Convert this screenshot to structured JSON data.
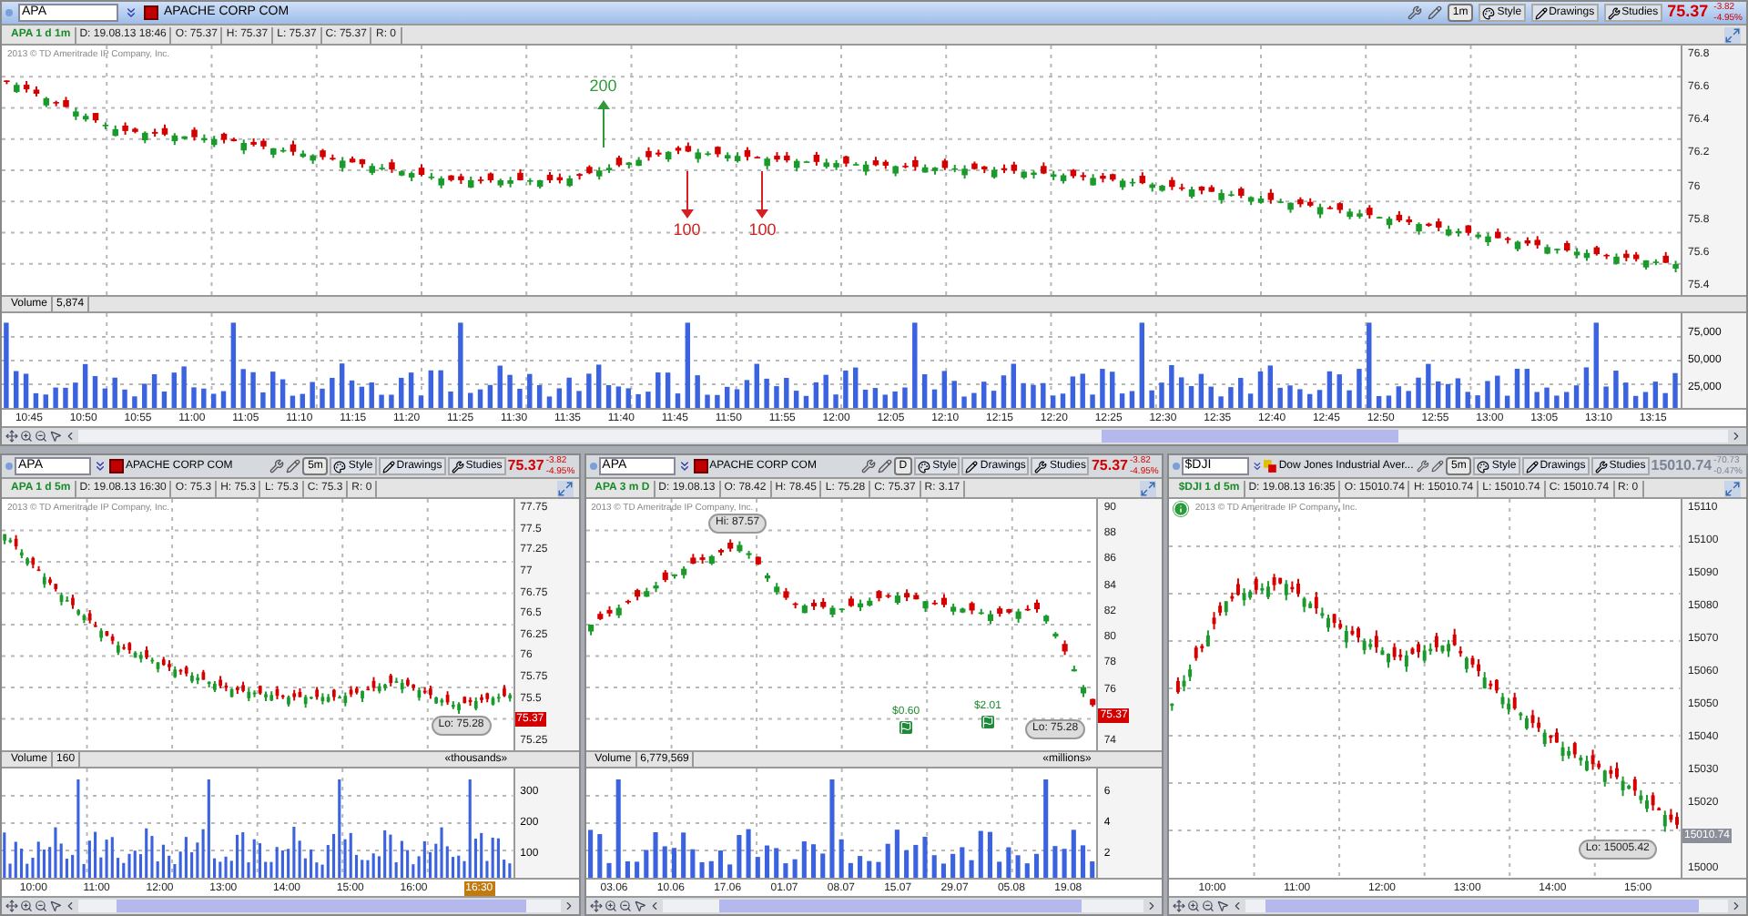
{
  "panels": [
    {
      "symbol": "APA",
      "company": "APACHE CORP COM",
      "interval": "1m",
      "style": "Style",
      "drawings": "Drawings",
      "studies": "Studies",
      "price": "75.37",
      "color": "#d40000",
      "change": "-3.82",
      "change_pct": "-4.95%",
      "info": [
        "APA 1 d 1m",
        "D: 19.08.13 18:46",
        "O: 75.37",
        "H: 75.37",
        "L: 75.37",
        "C: 75.37",
        "R: 0"
      ],
      "copyright": "2013 © TD Ameritrade IP Company, Inc.",
      "price_axis": [
        {
          "kind": "tick",
          "label": "76.8"
        },
        {
          "kind": "tick",
          "label": "76.6"
        },
        {
          "kind": "tick",
          "label": "76.4"
        },
        {
          "kind": "tick",
          "label": "76.2"
        },
        {
          "kind": "tick",
          "label": "76"
        },
        {
          "kind": "tick",
          "label": "75.8"
        },
        {
          "kind": "tick",
          "label": "75.6"
        },
        {
          "kind": "tick",
          "label": "75.4"
        }
      ],
      "annotations": [
        {
          "kind": "up_arrow",
          "label": "200"
        },
        {
          "kind": "down_arrow",
          "label": "100"
        },
        {
          "kind": "down_arrow",
          "label": "100"
        }
      ],
      "volume": {
        "label": "Volume",
        "value": "5,874",
        "axis": [
          "75,000",
          "50,000",
          "25,000"
        ]
      },
      "time_axis": [
        {
          "kind": "tick",
          "label": "10:45"
        },
        {
          "kind": "tick",
          "label": "10:50"
        },
        {
          "kind": "tick",
          "label": "10:55"
        },
        {
          "kind": "tick",
          "label": "11:00"
        },
        {
          "kind": "tick",
          "label": "11:05"
        },
        {
          "kind": "tick",
          "label": "11:10"
        },
        {
          "kind": "tick",
          "label": "11:15"
        },
        {
          "kind": "tick",
          "label": "11:20"
        },
        {
          "kind": "tick",
          "label": "11:25"
        },
        {
          "kind": "tick",
          "label": "11:30"
        },
        {
          "kind": "tick",
          "label": "11:35"
        },
        {
          "kind": "tick",
          "label": "11:40"
        },
        {
          "kind": "tick",
          "label": "11:45"
        },
        {
          "kind": "tick",
          "label": "11:50"
        },
        {
          "kind": "tick",
          "label": "11:55"
        },
        {
          "kind": "tick",
          "label": "12:00"
        },
        {
          "kind": "tick",
          "label": "12:05"
        },
        {
          "kind": "tick",
          "label": "12:10"
        },
        {
          "kind": "tick",
          "label": "12:15"
        },
        {
          "kind": "tick",
          "label": "12:20"
        },
        {
          "kind": "tick",
          "label": "12:25"
        },
        {
          "kind": "tick",
          "label": "12:30"
        },
        {
          "kind": "tick",
          "label": "12:35"
        },
        {
          "kind": "tick",
          "label": "12:40"
        },
        {
          "kind": "tick",
          "label": "12:45"
        },
        {
          "kind": "tick",
          "label": "12:50"
        },
        {
          "kind": "tick",
          "label": "12:55"
        },
        {
          "kind": "tick",
          "label": "13:00"
        },
        {
          "kind": "tick",
          "label": "13:05"
        },
        {
          "kind": "tick",
          "label": "13:10"
        },
        {
          "kind": "tick",
          "label": "13:15"
        }
      ]
    },
    {
      "symbol": "APA",
      "company": "APACHE CORP COM",
      "interval": "5m",
      "style": "Style",
      "drawings": "Drawings",
      "studies": "Studies",
      "price": "75.37",
      "color": "#d40000",
      "change": "-3.82",
      "change_pct": "-4.95%",
      "info": [
        "APA 1 d 5m",
        "D: 19.08.13 16:30",
        "O: 75.3",
        "H: 75.3",
        "L: 75.3",
        "C: 75.3",
        "R: 0"
      ],
      "copyright": "2013 © TD Ameritrade IP Company, Inc.",
      "price_axis": [
        {
          "kind": "tick",
          "label": "77.75"
        },
        {
          "kind": "tick",
          "label": "77.5"
        },
        {
          "kind": "tick",
          "label": "77.25"
        },
        {
          "kind": "tick",
          "label": "77"
        },
        {
          "kind": "tick",
          "label": "76.75"
        },
        {
          "kind": "tick",
          "label": "76.5"
        },
        {
          "kind": "tick",
          "label": "76.25"
        },
        {
          "kind": "tick",
          "label": "76"
        },
        {
          "kind": "tick",
          "label": "75.75"
        },
        {
          "kind": "tick",
          "label": "75.5"
        },
        {
          "kind": "badge",
          "label": "75.37",
          "color": "#d40000"
        },
        {
          "kind": "tick",
          "label": "75.25"
        }
      ],
      "annotations": [
        {
          "kind": "bubble",
          "label": "Lo: 75.28"
        }
      ],
      "volume": {
        "label": "Volume",
        "value": "160",
        "unit": "«thousands»",
        "axis": [
          "300",
          "200",
          "100"
        ]
      },
      "time_axis": [
        {
          "kind": "tick",
          "label": "10:00"
        },
        {
          "kind": "tick",
          "label": "11:00"
        },
        {
          "kind": "tick",
          "label": "12:00"
        },
        {
          "kind": "tick",
          "label": "13:00"
        },
        {
          "kind": "tick",
          "label": "14:00"
        },
        {
          "kind": "tick",
          "label": "15:00"
        },
        {
          "kind": "tick",
          "label": "16:00"
        },
        {
          "kind": "badge",
          "label": "16:30",
          "color": "#c07a10"
        }
      ]
    },
    {
      "symbol": "APA",
      "company": "APACHE CORP COM",
      "interval": "D",
      "style": "Style",
      "drawings": "Drawings",
      "studies": "Studies",
      "price": "75.37",
      "color": "#d40000",
      "change": "-3.82",
      "change_pct": "-4.95%",
      "info": [
        "APA 3 m D",
        "D: 19.08.13",
        "O: 78.42",
        "H: 78.45",
        "L: 75.28",
        "C: 75.37",
        "R: 3.17"
      ],
      "copyright": "2013 © TD Ameritrade IP Company, Inc.",
      "price_axis": [
        {
          "kind": "tick",
          "label": "90"
        },
        {
          "kind": "tick",
          "label": "88"
        },
        {
          "kind": "tick",
          "label": "86"
        },
        {
          "kind": "tick",
          "label": "84"
        },
        {
          "kind": "tick",
          "label": "82"
        },
        {
          "kind": "tick",
          "label": "80"
        },
        {
          "kind": "tick",
          "label": "78"
        },
        {
          "kind": "tick",
          "label": "76"
        },
        {
          "kind": "badge",
          "label": "75.37",
          "color": "#d40000"
        },
        {
          "kind": "tick",
          "label": "74"
        }
      ],
      "annotations": [
        {
          "kind": "bubble",
          "label": "Hi: 87.57"
        },
        {
          "kind": "bubble",
          "label": "Lo: 75.28"
        },
        {
          "kind": "dividend",
          "label": "$0.60"
        },
        {
          "kind": "dividend",
          "label": "$2.01"
        }
      ],
      "volume": {
        "label": "Volume",
        "value": "6,779,569",
        "unit": "«millions»",
        "axis": [
          "6",
          "4",
          "2"
        ]
      },
      "time_axis": [
        {
          "kind": "tick",
          "label": "03.06"
        },
        {
          "kind": "tick",
          "label": "10.06"
        },
        {
          "kind": "tick",
          "label": "17.06"
        },
        {
          "kind": "tick",
          "label": "01.07"
        },
        {
          "kind": "tick",
          "label": "08.07"
        },
        {
          "kind": "tick",
          "label": "15.07"
        },
        {
          "kind": "tick",
          "label": "29.07"
        },
        {
          "kind": "tick",
          "label": "05.08"
        },
        {
          "kind": "tick",
          "label": "19.08"
        }
      ]
    },
    {
      "symbol": "$DJI",
      "company": "Dow Jones Industrial Aver...",
      "interval": "5m",
      "style": "Style",
      "drawings": "Drawings",
      "studies": "Studies",
      "price": "15010.74",
      "color": "#7a8494",
      "change": "-70.73",
      "change_pct": "-0.47%",
      "info": [
        "$DJI 1 d 5m",
        "D: 19.08.13 16:35",
        "O: 15010.74",
        "H: 15010.74",
        "L: 15010.74",
        "C: 15010.74",
        "R: 0"
      ],
      "copyright": "2013 © TD Ameritrade IP Company, Inc.",
      "price_axis": [
        {
          "kind": "tick",
          "label": "15110"
        },
        {
          "kind": "tick",
          "label": "15100"
        },
        {
          "kind": "tick",
          "label": "15090"
        },
        {
          "kind": "tick",
          "label": "15080"
        },
        {
          "kind": "tick",
          "label": "15070"
        },
        {
          "kind": "tick",
          "label": "15060"
        },
        {
          "kind": "tick",
          "label": "15050"
        },
        {
          "kind": "tick",
          "label": "15040"
        },
        {
          "kind": "tick",
          "label": "15030"
        },
        {
          "kind": "tick",
          "label": "15020"
        },
        {
          "kind": "badge",
          "label": "15010.74",
          "color": "#8a8f99"
        },
        {
          "kind": "tick",
          "label": "15000"
        }
      ],
      "annotations": [
        {
          "kind": "bubble",
          "label": "Lo: 15005.42"
        }
      ],
      "time_axis": [
        {
          "kind": "tick",
          "label": "10:00"
        },
        {
          "kind": "tick",
          "label": "11:00"
        },
        {
          "kind": "tick",
          "label": "12:00"
        },
        {
          "kind": "tick",
          "label": "13:00"
        },
        {
          "kind": "tick",
          "label": "14:00"
        },
        {
          "kind": "tick",
          "label": "15:00"
        }
      ]
    }
  ]
}
